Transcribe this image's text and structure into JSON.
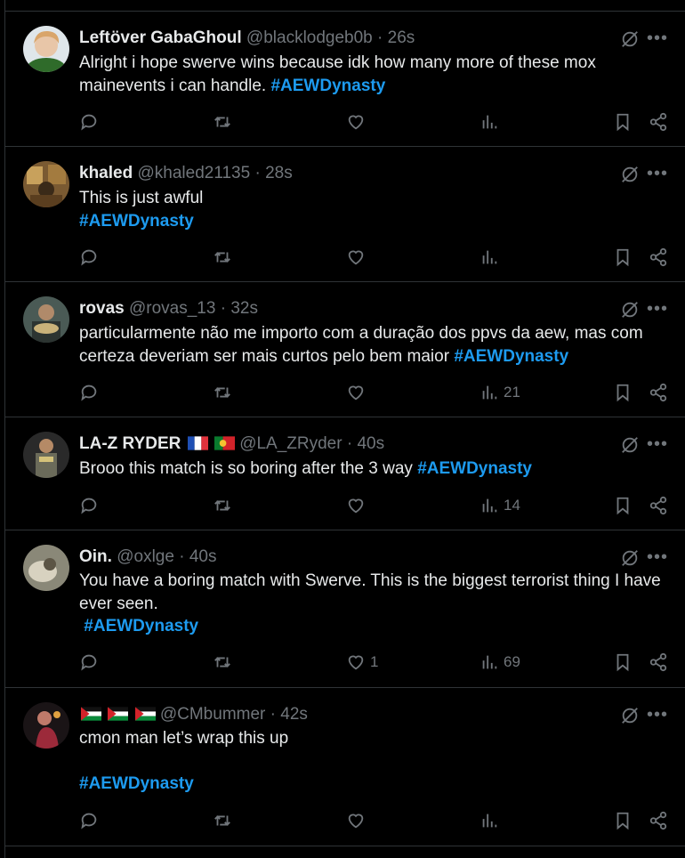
{
  "tweets": [
    {
      "name": "Leftöver GabaGhoul",
      "handle": "@blacklodgeb0b",
      "time": "· 26s",
      "text_before": "Alright i hope swerve wins because idk how many more of these mox mainevents i can handle. ",
      "hashtag": "#AEWDynasty",
      "likes": "",
      "views": ""
    },
    {
      "name": "khaled",
      "handle": "@khaled21135",
      "time": "· 28s",
      "text_before": "This is just awful\n",
      "hashtag": "#AEWDynasty",
      "likes": "",
      "views": ""
    },
    {
      "name": "rovas",
      "handle": "@rovas_13",
      "time": "· 32s",
      "text_before": "particularmente não me importo com a duração dos ppvs da aew, mas com certeza deveriam ser mais curtos pelo bem maior ",
      "hashtag": "#AEWDynasty",
      "likes": "",
      "views": "21"
    },
    {
      "name": "LA-Z RYDER",
      "handle": "@LA_ZRyder",
      "time": "· 40s",
      "text_before": "Brooo this match is so boring after the 3 way ",
      "hashtag": "#AEWDynasty",
      "likes": "",
      "views": "14"
    },
    {
      "name": "Oin.",
      "handle": "@oxlge",
      "time": "· 40s",
      "text_before": "You have a boring match with Swerve. This is the biggest terrorist thing I have ever seen.\n ",
      "hashtag": "#AEWDynasty",
      "likes": "1",
      "views": "69"
    },
    {
      "name": "",
      "handle": "@CMbummer",
      "time": "· 42s",
      "text_before": "cmon man let’s wrap this up\n\n",
      "hashtag": "#AEWDynasty",
      "likes": "",
      "views": ""
    }
  ],
  "colors": {
    "background": "#000000",
    "text": "#e7e9ea",
    "muted": "#71767b",
    "hashtag": "#1d9bf0",
    "divider": "#2f3336"
  },
  "icons": [
    "grok-icon",
    "more-icon",
    "reply-icon",
    "repost-icon",
    "like-icon",
    "views-icon",
    "bookmark-icon",
    "share-icon",
    "france-flag-icon",
    "portugal-flag-icon",
    "palestine-flag-icon"
  ]
}
